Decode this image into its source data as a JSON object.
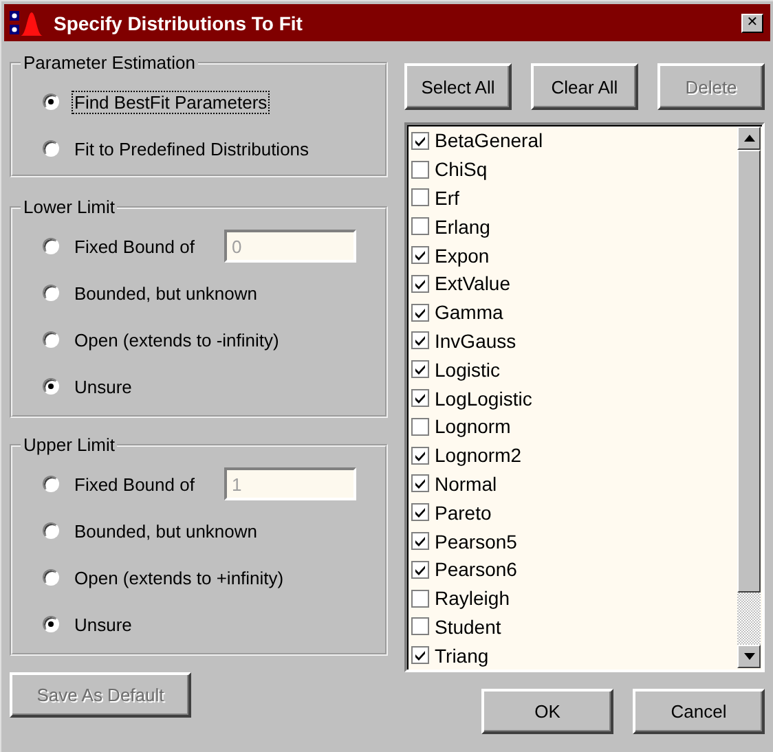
{
  "window": {
    "title": "Specify Distributions To Fit",
    "close": "✕"
  },
  "groups": [
    {
      "title": "Parameter Estimation",
      "options": [
        {
          "label": "Find BestFit Parameters",
          "selected": true,
          "focused": true
        },
        {
          "label": "Fit to Predefined Distributions",
          "selected": false,
          "focused": false
        }
      ]
    },
    {
      "title": "Lower Limit",
      "options": [
        {
          "label": "Fixed Bound of",
          "selected": false,
          "focused": false,
          "field": {
            "value": "0",
            "disabled": true
          }
        },
        {
          "label": "Bounded, but unknown",
          "selected": false,
          "focused": false
        },
        {
          "label": "Open (extends to -infinity)",
          "selected": false,
          "focused": false
        },
        {
          "label": "Unsure",
          "selected": true,
          "focused": false
        }
      ]
    },
    {
      "title": "Upper Limit",
      "options": [
        {
          "label": "Fixed Bound of",
          "selected": false,
          "focused": false,
          "field": {
            "value": "1",
            "disabled": true
          }
        },
        {
          "label": "Bounded, but unknown",
          "selected": false,
          "focused": false
        },
        {
          "label": "Open (extends to +infinity)",
          "selected": false,
          "focused": false
        },
        {
          "label": "Unsure",
          "selected": true,
          "focused": false
        }
      ]
    }
  ],
  "save_button": {
    "label": "Save As Default",
    "disabled": true
  },
  "list_buttons": [
    {
      "label": "Select All",
      "disabled": false
    },
    {
      "label": "Clear All",
      "disabled": false
    },
    {
      "label": "Delete",
      "disabled": true
    }
  ],
  "distributions": [
    {
      "label": "BetaGeneral",
      "checked": true
    },
    {
      "label": "ChiSq",
      "checked": false
    },
    {
      "label": "Erf",
      "checked": false
    },
    {
      "label": "Erlang",
      "checked": false
    },
    {
      "label": "Expon",
      "checked": true
    },
    {
      "label": "ExtValue",
      "checked": true
    },
    {
      "label": "Gamma",
      "checked": true
    },
    {
      "label": "InvGauss",
      "checked": true
    },
    {
      "label": "Logistic",
      "checked": true
    },
    {
      "label": "LogLogistic",
      "checked": true
    },
    {
      "label": "Lognorm",
      "checked": false
    },
    {
      "label": "Lognorm2",
      "checked": true
    },
    {
      "label": "Normal",
      "checked": true
    },
    {
      "label": "Pareto",
      "checked": true
    },
    {
      "label": "Pearson5",
      "checked": true
    },
    {
      "label": "Pearson6",
      "checked": true
    },
    {
      "label": "Rayleigh",
      "checked": false
    },
    {
      "label": "Student",
      "checked": false
    },
    {
      "label": "Triang",
      "checked": true
    }
  ],
  "dialog_buttons": [
    {
      "label": "OK",
      "disabled": false
    },
    {
      "label": "Cancel",
      "disabled": false
    }
  ]
}
